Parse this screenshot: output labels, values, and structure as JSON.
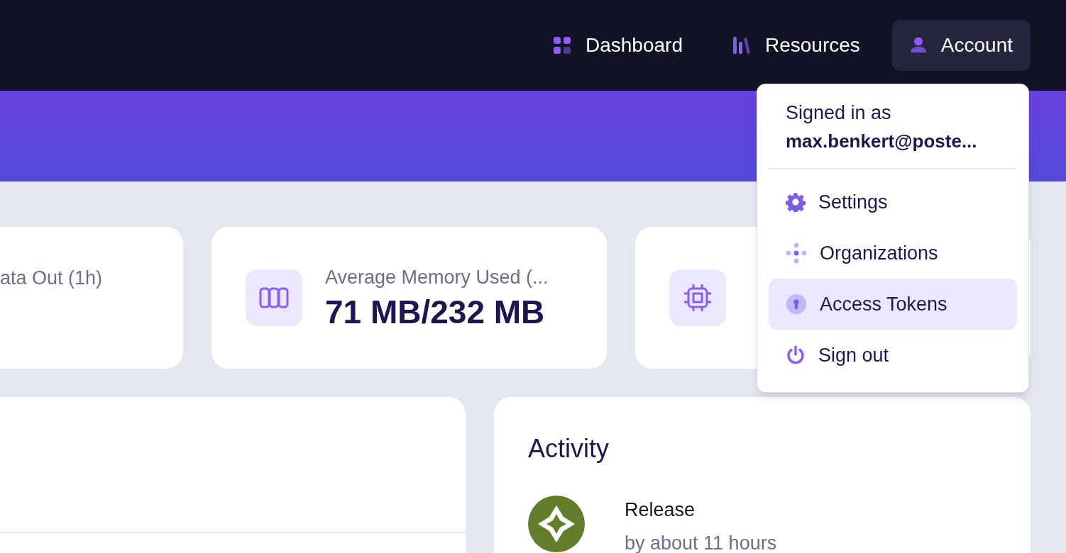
{
  "nav": {
    "items": [
      {
        "label": "Dashboard",
        "kind": "grid",
        "selected": false
      },
      {
        "label": "Resources",
        "kind": "books",
        "selected": false
      },
      {
        "label": "Account",
        "kind": "user",
        "selected": true
      }
    ]
  },
  "stats": [
    {
      "label": "ata Out (1h)",
      "kind": "plain"
    },
    {
      "label": "Average Memory Used (...",
      "value": "71 MB/232 MB",
      "kind": "memory"
    },
    {
      "kind": "cpu"
    }
  ],
  "activity": {
    "title": "Activity",
    "items": [
      {
        "title": "Release",
        "subtitle": "by about 11 hours"
      }
    ]
  },
  "account_menu": {
    "signed_in_label": "Signed in as",
    "email": "max.benkert@poste...",
    "items": [
      {
        "label": "Settings",
        "kind": "gear",
        "selected": false
      },
      {
        "label": "Organizations",
        "kind": "dots",
        "selected": false
      },
      {
        "label": "Access Tokens",
        "kind": "key",
        "selected": true
      },
      {
        "label": "Sign out",
        "kind": "power",
        "selected": false
      }
    ]
  }
}
